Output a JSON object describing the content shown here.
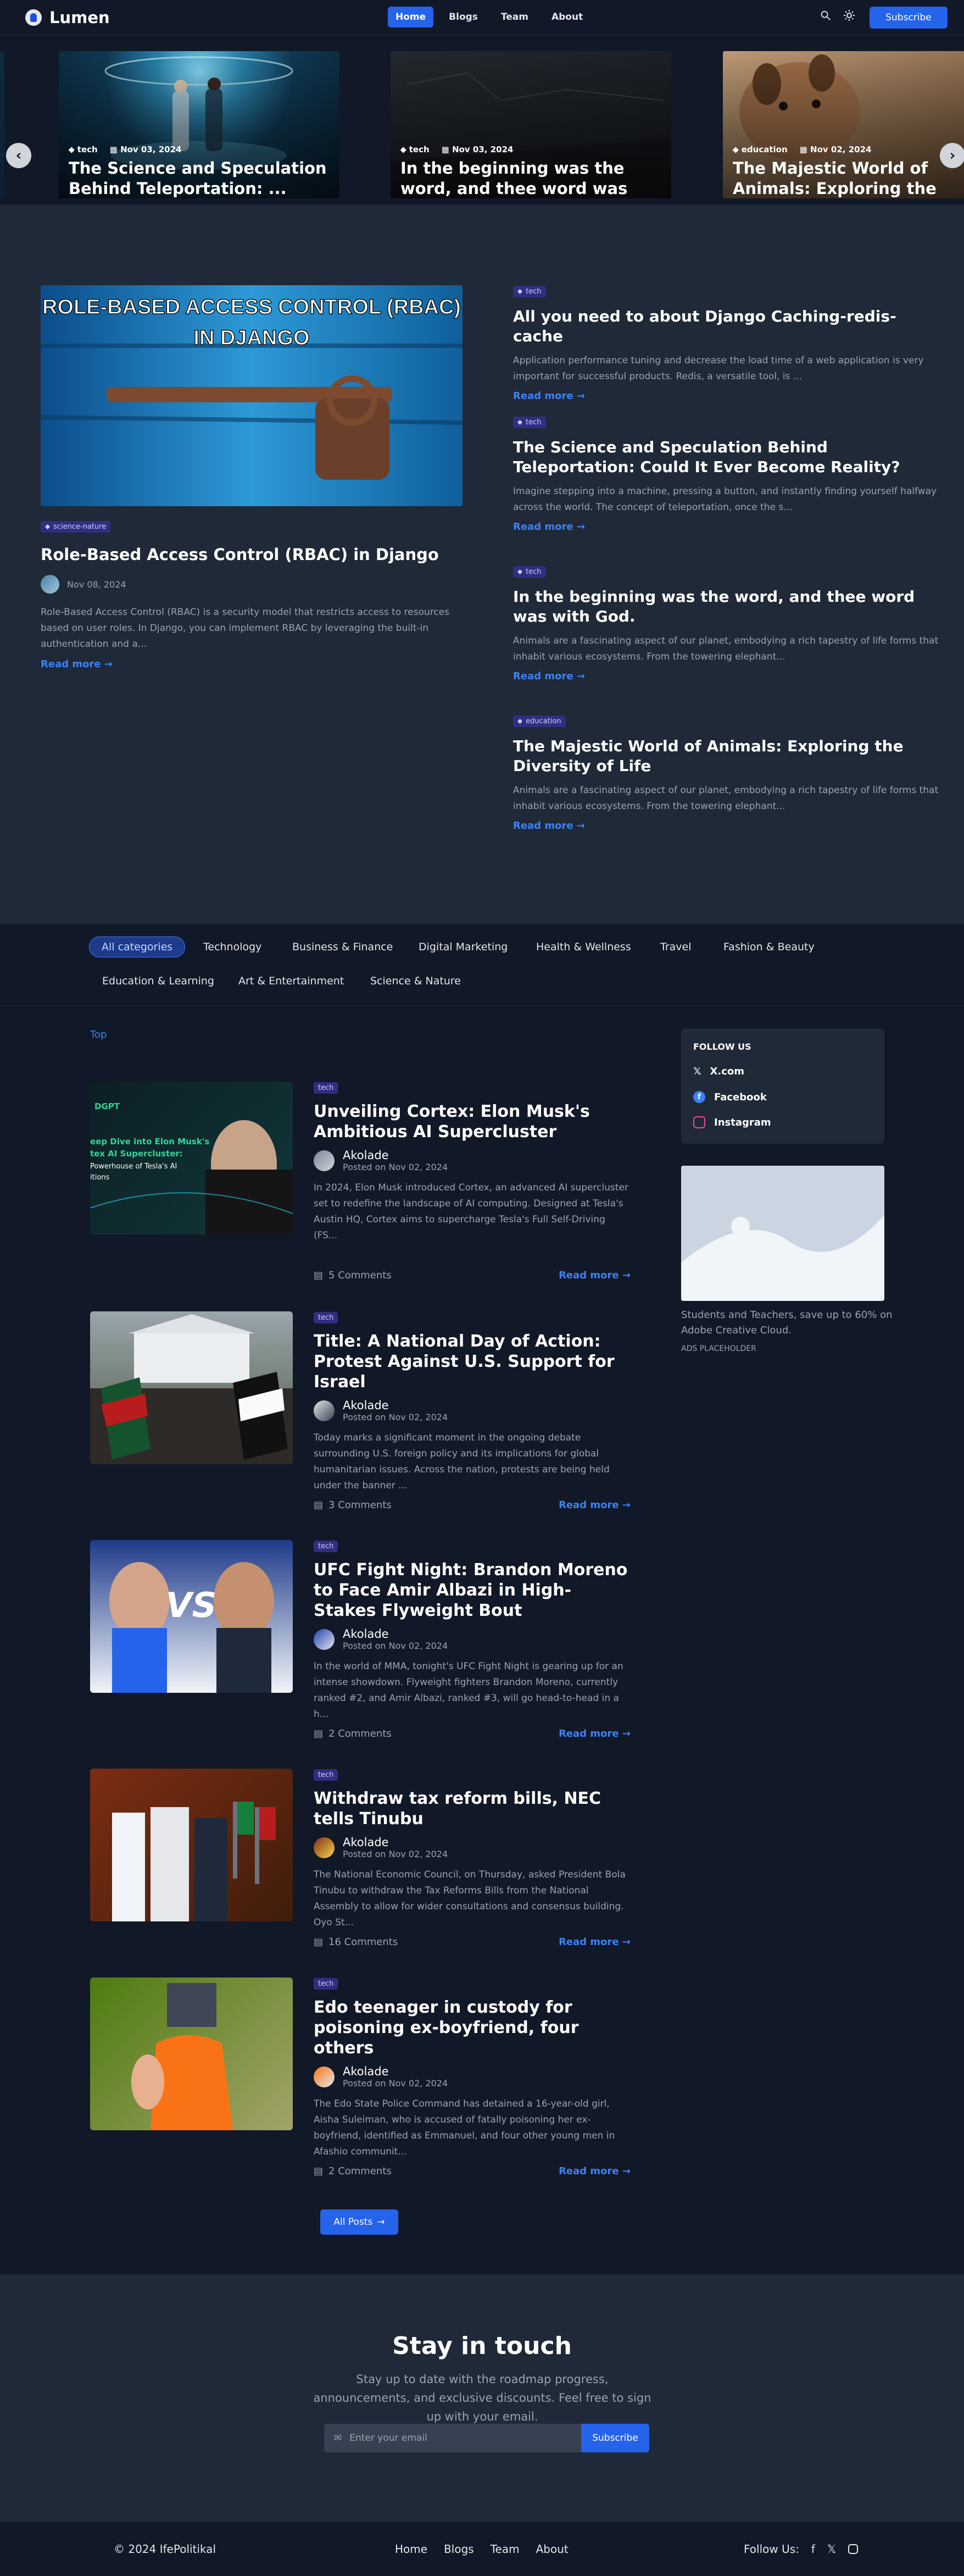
{
  "nav": {
    "brand": "Lumen",
    "links": [
      "Home",
      "Blogs",
      "Team",
      "About"
    ],
    "subscribe": "Subscribe",
    "search_icon": "search-icon",
    "theme_icon": "sun-icon"
  },
  "slider": {
    "slides": [
      {
        "category": "tech",
        "date": "Nov 03, 2024",
        "title": "The Science and Speculation Behind Teleportation: ..."
      },
      {
        "category": "tech",
        "date": "Nov 03, 2024",
        "title": "In the beginning was the word, and thee word was w..."
      },
      {
        "category": "education",
        "date": "Nov 02, 2024",
        "title": "The Majestic World of Animals: Exploring the Diver..."
      }
    ],
    "prev_icon": "chevron-left-icon",
    "next_icon": "chevron-right-icon",
    "active_dot": 1
  },
  "featured": {
    "image_text_1": "ROLE-BASED ACCESS CONTROL (RBAC)",
    "image_text_2": "IN DJANGO",
    "category": "science-nature",
    "title": "Role-Based Access Control (RBAC) in Django",
    "date": "Nov 08, 2024",
    "excerpt": "Role-Based Access Control (RBAC) is a security model that restricts access to resources based on user roles. In Django, you can implement RBAC by leveraging the built-in authentication and a...",
    "read_more": "Read more"
  },
  "side_posts": [
    {
      "category": "tech",
      "title": "All you need to about Django Caching-redis-cache",
      "excerpt": "Application performance tuning and decrease the load time of a web application is very important for successful products. Redis, a versatile tool, is ...",
      "read_more": "Read more"
    },
    {
      "category": "tech",
      "title": "The Science and Speculation Behind Teleportation: Could It Ever Become Reality?",
      "excerpt": "Imagine stepping into a machine, pressing a button, and instantly finding yourself halfway across the world. The concept of teleportation, once the s...",
      "read_more": "Read more"
    },
    {
      "category": "tech",
      "title": "In the beginning was the word, and thee word was with God.",
      "excerpt": "Animals are a fascinating aspect of our planet, embodying a rich tapestry of life forms that inhabit various ecosystems. From the towering elephant...",
      "read_more": "Read more"
    },
    {
      "category": "education",
      "title": "The Majestic World of Animals: Exploring the Diversity of Life",
      "excerpt": "Animals are a fascinating aspect of our planet, embodying a rich tapestry of life forms that inhabit various ecosystems. From the towering elephant...",
      "read_more": "Read more"
    }
  ],
  "categories": [
    "All categories",
    "Technology",
    "Business & Finance",
    "Digital Marketing",
    "Health & Wellness",
    "Travel",
    "Fashion & Beauty",
    "Education & Learning",
    "Art & Entertainment",
    "Science & Nature"
  ],
  "top_label": "Top",
  "posts": [
    {
      "category": "tech",
      "title": "Unveiling Cortex: Elon Musk's Ambitious AI Supercluster",
      "author": "Akolade",
      "posted": "Posted on Nov 02, 2024",
      "excerpt": "In 2024, Elon Musk introduced Cortex, an advanced AI supercluster set to redefine the landscape of AI computing. Designed at Tesla's Austin HQ, Cortex aims to supercharge Tesla's Full Self-Driving (FS...",
      "comments": "5 Comments",
      "read_more": "Read more",
      "image_text": [
        "DGPT",
        "eep Dive into Elon Musk's",
        "tex AI Supercluster:",
        "Powerhouse of Tesla's AI",
        "itions"
      ]
    },
    {
      "category": "tech",
      "title": "Title: A National Day of Action: Protest Against U.S. Support for Israel",
      "author": "Akolade",
      "posted": "Posted on Nov 02, 2024",
      "excerpt": "Today marks a significant moment in the ongoing debate surrounding U.S. foreign policy and its implications for global humanitarian issues. Across the nation, protests are being held under the banner ...",
      "comments": "3 Comments",
      "read_more": "Read more"
    },
    {
      "category": "tech",
      "title": "UFC Fight Night: Brandon Moreno to Face Amir Albazi in High-Stakes Flyweight Bout",
      "author": "Akolade",
      "posted": "Posted on Nov 02, 2024",
      "excerpt": "In the world of MMA, tonight's UFC Fight Night is gearing up for an intense showdown. Flyweight fighters Brandon Moreno, currently ranked #2, and Amir Albazi, ranked #3, will go head-to-head in a h...",
      "comments": "2 Comments",
      "read_more": "Read more",
      "image_text": [
        "VS"
      ]
    },
    {
      "category": "tech",
      "title": "Withdraw tax reform bills, NEC tells Tinubu",
      "author": "Akolade",
      "posted": "Posted on Nov 02, 2024",
      "excerpt": "The National Economic Council, on Thursday, asked President Bola Tinubu to withdraw the Tax Reforms Bills from the National Assembly to allow for wider consultations and consensus building. Oyo St...",
      "comments": "16 Comments",
      "read_more": "Read more"
    },
    {
      "category": "tech",
      "title": "Edo teenager in custody for poisoning ex-boyfriend, four others",
      "author": "Akolade",
      "posted": "Posted on Nov 02, 2024",
      "excerpt": "The Edo State Police Command has detained a 16-year-old girl, Aisha Suleiman, who is accused of fatally poisoning her ex-boyfriend, identified as Emmanuel, and four other young men in Afashio communit...",
      "comments": "2 Comments",
      "read_more": "Read more"
    }
  ],
  "follow": {
    "title": "FOLLOW US",
    "links": [
      "X.com",
      "Facebook",
      "Instagram"
    ]
  },
  "ad": {
    "text": "Students and Teachers, save up to 60% on Adobe Creative Cloud.",
    "tag": "ADS PLACEHOLDER"
  },
  "all_posts": "All Posts",
  "stay": {
    "title": "Stay in touch",
    "text": "Stay up to date with the roadmap progress, announcements, and exclusive discounts. Feel free to sign up with your email.",
    "placeholder": "Enter your email",
    "button": "Subscribe"
  },
  "footer": {
    "copy": "© 2024 IfePolitikal",
    "links": [
      "Home",
      "Blogs",
      "Team",
      "About"
    ],
    "follow": "Follow Us:"
  }
}
